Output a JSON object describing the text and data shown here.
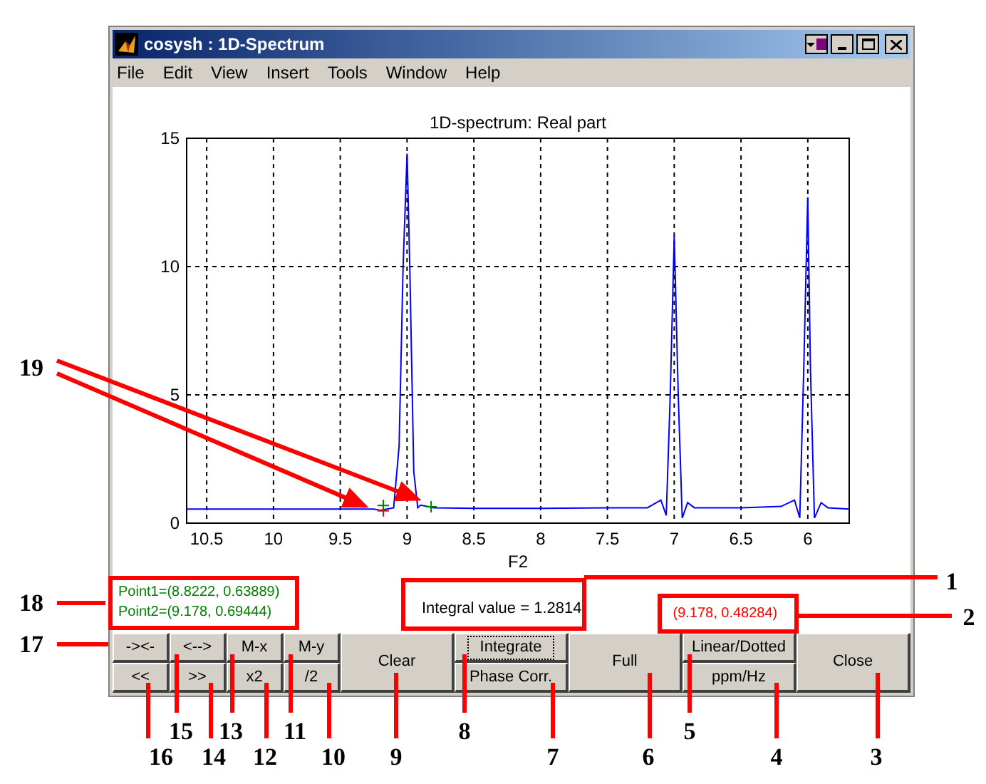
{
  "window": {
    "title": "cosysh : 1D-Spectrum"
  },
  "menu": [
    "File",
    "Edit",
    "View",
    "Insert",
    "Tools",
    "Window",
    "Help"
  ],
  "plot": {
    "chart_data": {
      "type": "line",
      "title": "1D-spectrum: Real part",
      "xlabel": "F2",
      "grid": true,
      "xlim": [
        10.65,
        5.69
      ],
      "ylim": [
        0,
        15
      ],
      "xticks": [
        10.5,
        10,
        9.5,
        9,
        8.5,
        8,
        7.5,
        7,
        6.5,
        6
      ],
      "yticks": [
        0,
        5,
        10,
        15
      ],
      "x": [
        10.65,
        9.25,
        9.2,
        9.15,
        9.1,
        9.06,
        9.03,
        9.0,
        8.98,
        8.95,
        8.92,
        8.9,
        8.85,
        8.8,
        8.5,
        8,
        7.5,
        7.2,
        7.1,
        7.06,
        7.03,
        7.0,
        6.97,
        6.94,
        6.9,
        6.85,
        6.5,
        6.2,
        6.1,
        6.06,
        6.03,
        6.0,
        5.98,
        5.95,
        5.9,
        5.85,
        5.69
      ],
      "series": [
        {
          "color": "#0000ff",
          "values": [
            0.55,
            0.55,
            0.5,
            0.55,
            0.6,
            3,
            10,
            14.4,
            10,
            2,
            0.6,
            0.7,
            0.65,
            0.6,
            0.58,
            0.58,
            0.6,
            0.6,
            0.9,
            0.3,
            5,
            11.2,
            5,
            0.2,
            0.8,
            0.6,
            0.6,
            0.65,
            0.9,
            0.2,
            6,
            12.7,
            6,
            0.2,
            0.8,
            0.6,
            0.55
          ]
        }
      ]
    }
  },
  "readouts": {
    "points": [
      "Point1=(8.8222, 0.63889)",
      "Point2=(9.178, 0.69444)"
    ],
    "integral": "Integral value = 1.2814",
    "cursor": "(9.178, 0.48284)"
  },
  "button_columns": [
    [
      {
        "label": "-><-",
        "focused": false
      },
      {
        "label": "<<",
        "focused": false
      }
    ],
    [
      {
        "label": "<-->",
        "focused": false
      },
      {
        "label": ">>",
        "focused": false
      }
    ],
    [
      {
        "label": "M-x",
        "focused": false
      },
      {
        "label": "x2",
        "focused": false
      }
    ],
    [
      {
        "label": "M-y",
        "focused": false
      },
      {
        "label": "/2",
        "focused": false
      }
    ],
    [
      {
        "label": "Clear",
        "focused": false
      }
    ],
    [
      {
        "label": "Integrate",
        "focused": true
      },
      {
        "label": "Phase Corr.",
        "focused": false
      }
    ],
    [
      {
        "label": "Full",
        "focused": false
      }
    ],
    [
      {
        "label": "Linear/Dotted",
        "focused": false
      },
      {
        "label": "ppm/Hz",
        "focused": false
      }
    ],
    [
      {
        "label": "Close",
        "focused": false
      }
    ]
  ],
  "callouts": [
    {
      "label": "19"
    },
    {
      "label": "1"
    },
    {
      "label": "18"
    },
    {
      "label": "2"
    },
    {
      "label": "17"
    },
    {
      "label": "15"
    },
    {
      "label": "13"
    },
    {
      "label": "11"
    },
    {
      "label": "8"
    },
    {
      "label": "5"
    },
    {
      "label": "16"
    },
    {
      "label": "14"
    },
    {
      "label": "12"
    },
    {
      "label": "10"
    },
    {
      "label": "9"
    },
    {
      "label": "7"
    },
    {
      "label": "6"
    },
    {
      "label": "4"
    },
    {
      "label": "3"
    }
  ]
}
